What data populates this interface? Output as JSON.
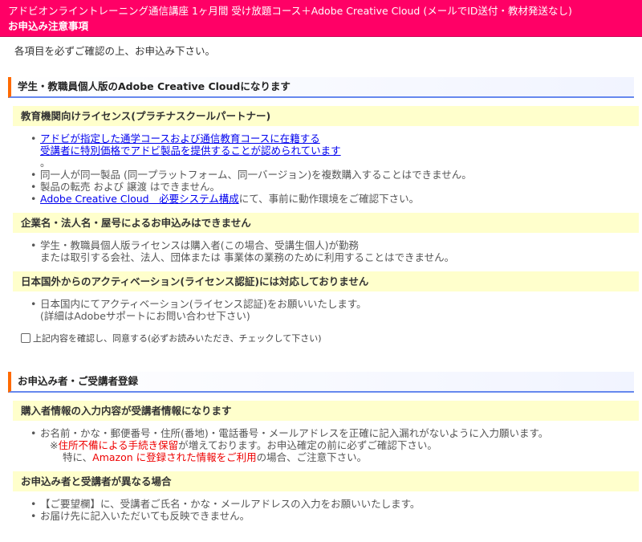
{
  "header": {
    "title": "アドビオンライントレーニング通信講座 1ヶ月間 受け放題コース＋Adobe Creative Cloud (メールでID送付・教材発送なし)",
    "subtitle": "お申込み注意事項"
  },
  "intro": "各項目を必ずご確認の上、お申込み下さい。",
  "section1": {
    "title": "学生・教職員個人版のAdobe Creative Cloudになります",
    "sub1": {
      "title": "教育機関向けライセンス(プラチナスクールパートナー)",
      "item1_link_line1": "アドビが指定した通学コースおよび通信教育コースに在籍する",
      "item1_link_line2": "受講者に特別価格でアドビ製品を提供することが認められています",
      "item1_suffix": "。",
      "item2": "同一人が同一製品 (同一プラットフォーム、同一バージョン)を複数購入することはできません。",
      "item3": "製品の転売 および 譲渡 はできません。",
      "item4_link": "Adobe Creative Cloud　必要システム構成",
      "item4_suffix": "にて、事前に動作環境をご確認下さい。"
    },
    "sub2": {
      "title": "企業名・法人名・屋号によるお申込みはできません",
      "item1_line1": "学生・教職員個人版ライセンスは購入者(この場合、受講生個人)が勤務",
      "item1_line2": "または取引する会社、法人、団体または 事業体の業務のために利用することはできません。"
    },
    "sub3": {
      "title": "日本国外からのアクティベーション(ライセンス認証)には対応しておりません",
      "item1_line1": "日本国内にてアクティベーション(ライセンス認証)をお願いいたします。",
      "item1_line2": "(詳細はAdobeサポートにお問い合わせ下さい)"
    },
    "agree_label": "上記内容を確認し、同意する(必ずお読みいただき、チェックして下さい)",
    "agree_checked": false
  },
  "section2": {
    "title": "お申込み者・ご受講者登録",
    "sub1": {
      "title": "購入者情報の入力内容が受講者情報になります",
      "item1_line1": "お名前・かな・郵便番号・住所(番地)・電話番号・メールアドレスを正確に記入漏れがないように入力願います。",
      "line2_prefix": "※",
      "line2_red": "住所不備による手続き保留",
      "line2_suffix": "が増えております。お申込確定の前に必ずご確認下さい。",
      "line3_prefix": "特に、",
      "line3_red": "Amazon に登録された情報をご利用",
      "line3_suffix": "の場合、ご注意下さい。"
    },
    "sub2": {
      "title": "お申込み者と受講者が異なる場合",
      "item1": "【ご要望欄】に、受講者ご氏名・かな・メールアドレスの入力をお願いいたします。",
      "item2": "お届け先に記入いただいても反映できません。"
    }
  },
  "colors": {
    "header_bg": "#ff0066",
    "section_accent": "#ff6a00",
    "section_underline": "#6688ee",
    "subheader_bg": "#ffffcc",
    "link": "#0000ee",
    "warning": "#ee0000"
  }
}
